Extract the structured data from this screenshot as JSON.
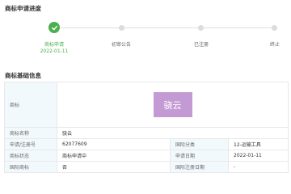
{
  "progress": {
    "title": "商标申请进度",
    "steps": [
      {
        "label": "商标申请",
        "date": "2022-01-11",
        "done": true
      },
      {
        "label": "初审公告",
        "done": false
      },
      {
        "label": "已注册",
        "done": false
      },
      {
        "label": "终止",
        "done": false
      }
    ],
    "done_color": "#4caf50",
    "pending_color": "#dcdcdc"
  },
  "info": {
    "title": "商标基础信息",
    "logo_label": "商标",
    "logo_text": "骁云",
    "logo_color": "#c49ad4",
    "rows": {
      "name_label": "商标名称",
      "name_value": "骁云",
      "reg_no_label": "申请/注册号",
      "reg_no_value": "62077609",
      "class_label": "国际分类",
      "class_value": "12-运输工具",
      "status_label": "商标状态",
      "status_value": "商标申请中",
      "apply_date_label": "申请日期",
      "apply_date_value": "2022-01-11",
      "intl_label": "国际商标",
      "intl_value": "否",
      "intl_date_label": "国际注册日期",
      "intl_date_value": "-"
    }
  }
}
